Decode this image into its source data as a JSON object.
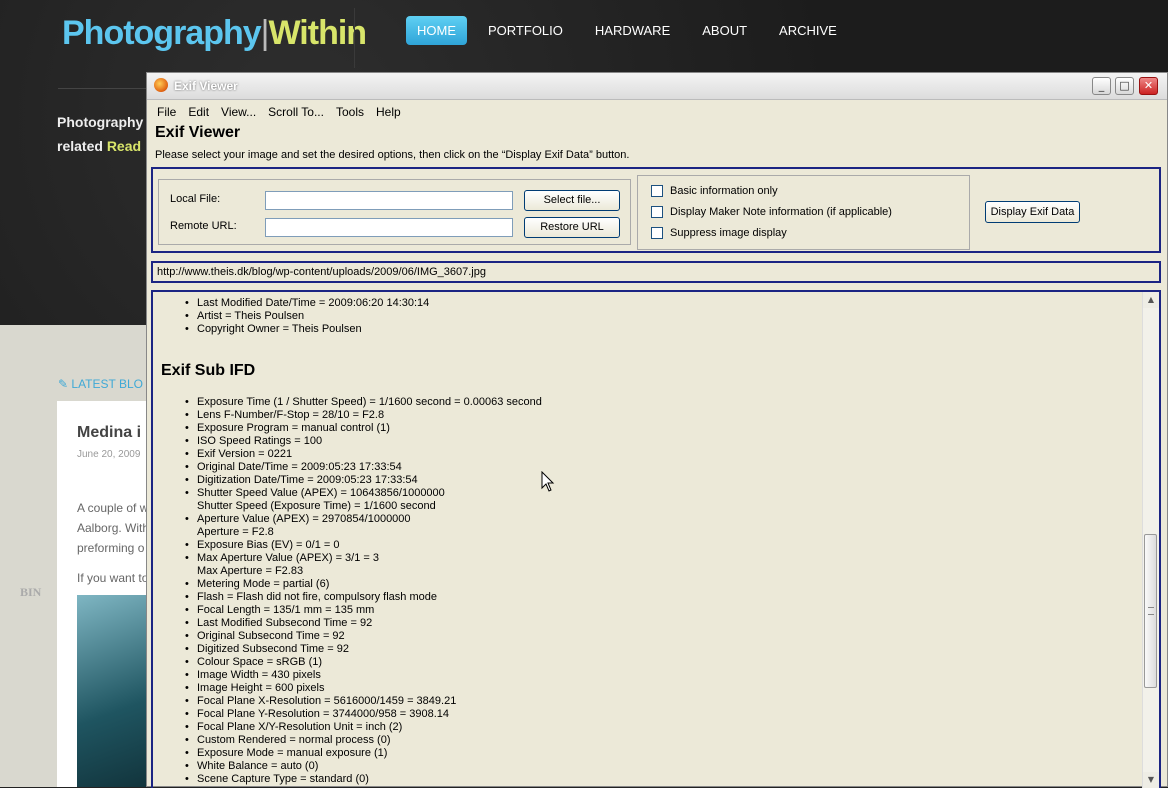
{
  "site": {
    "logo_left": "Photography",
    "logo_sep": "|",
    "logo_right": "Within",
    "nav": [
      "HOME",
      "PORTFOLIO",
      "HARDWARE",
      "ABOUT",
      "ARCHIVE"
    ],
    "intro_line1": "Photography",
    "intro_line2_start": "related ",
    "intro_read": "Read",
    "latest": "LATEST BLO",
    "post_title": "Medina i",
    "post_date": "June 20, 2009",
    "post_lines": [
      "A couple of w",
      "Aalborg. With",
      "preforming o",
      "",
      "If you want to"
    ],
    "bin_text": "BIN"
  },
  "window": {
    "title": "Exif Viewer",
    "menu": [
      "File",
      "Edit",
      "View...",
      "Scroll To...",
      "Tools",
      "Help"
    ],
    "app_title": "Exif Viewer",
    "instructions": "Please select your image and set the desired options, then click on the “Display Exif Data” button.",
    "local_file_label": "Local File:",
    "remote_url_label": "Remote URL:",
    "select_file_button": "Select file...",
    "restore_url_button": "Restore URL",
    "options": [
      "Basic information only",
      "Display Maker Note information (if applicable)",
      "Suppress image display"
    ],
    "display_button": "Display Exif Data",
    "url": "http://www.theis.dk/blog/wp-content/uploads/2009/06/IMG_3607.jpg",
    "top_items": [
      "Last Modified Date/Time = 2009:06:20 14:30:14",
      "Artist = Theis Poulsen",
      "Copyright Owner = Theis Poulsen"
    ],
    "section_title": "Exif Sub IFD",
    "exif_items": [
      {
        "t": "Exposure Time (1 / Shutter Speed) = 1/1600 second = 0.00063 second",
        "b": true
      },
      {
        "t": "Lens F-Number/F-Stop = 28/10 = F2.8",
        "b": true
      },
      {
        "t": "Exposure Program = manual control (1)",
        "b": true
      },
      {
        "t": "ISO Speed Ratings = 100",
        "b": true
      },
      {
        "t": "Exif Version = 0221",
        "b": true
      },
      {
        "t": "Original Date/Time = 2009:05:23 17:33:54",
        "b": true
      },
      {
        "t": "Digitization Date/Time = 2009:05:23 17:33:54",
        "b": true
      },
      {
        "t": "Shutter Speed Value (APEX) = 10643856/1000000",
        "b": true
      },
      {
        "t": "Shutter Speed (Exposure Time) = 1/1600 second",
        "b": false
      },
      {
        "t": "Aperture Value (APEX) = 2970854/1000000",
        "b": true
      },
      {
        "t": "Aperture = F2.8",
        "b": false
      },
      {
        "t": "Exposure Bias (EV) = 0/1 = 0",
        "b": true
      },
      {
        "t": "Max Aperture Value (APEX) = 3/1 = 3",
        "b": true
      },
      {
        "t": "Max Aperture = F2.83",
        "b": false
      },
      {
        "t": "Metering Mode = partial (6)",
        "b": true
      },
      {
        "t": "Flash = Flash did not fire, compulsory flash mode",
        "b": true
      },
      {
        "t": "Focal Length = 135/1 mm = 135 mm",
        "b": true
      },
      {
        "t": "Last Modified Subsecond Time = 92",
        "b": true
      },
      {
        "t": "Original Subsecond Time = 92",
        "b": true
      },
      {
        "t": "Digitized Subsecond Time = 92",
        "b": true
      },
      {
        "t": "Colour Space = sRGB (1)",
        "b": true
      },
      {
        "t": "Image Width = 430 pixels",
        "b": true
      },
      {
        "t": "Image Height = 600 pixels",
        "b": true
      },
      {
        "t": "Focal Plane X-Resolution = 5616000/1459 = 3849.21",
        "b": true
      },
      {
        "t": "Focal Plane Y-Resolution = 3744000/958 = 3908.14",
        "b": true
      },
      {
        "t": "Focal Plane X/Y-Resolution Unit = inch (2)",
        "b": true
      },
      {
        "t": "Custom Rendered = normal process (0)",
        "b": true
      },
      {
        "t": "Exposure Mode = manual exposure (1)",
        "b": true
      },
      {
        "t": "White Balance = auto (0)",
        "b": true
      },
      {
        "t": "Scene Capture Type = standard (0)",
        "b": true
      }
    ]
  }
}
